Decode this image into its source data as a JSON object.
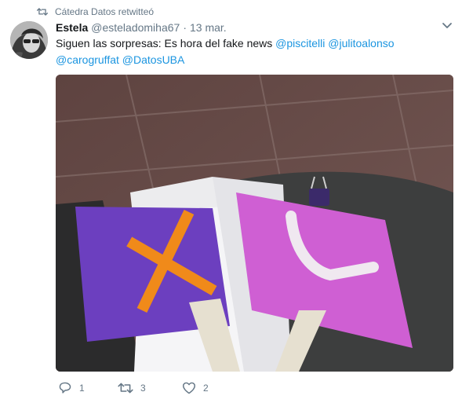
{
  "retweet_context": {
    "icon": "retweet-icon",
    "text": "Cátedra Datos retwitteó"
  },
  "tweet": {
    "author_name": "Estela",
    "author_handle": "@esteladomiha67",
    "separator": "·",
    "date": "13 mar.",
    "text_prefix": "Siguen las sorpresas: Es hora del fake news ",
    "mentions": [
      "@piscitelli",
      "@julitoalonso",
      "@carogruffat",
      "@DatosUBA"
    ],
    "media_icon": "photo-of-purple-and-pink-paper-signs"
  },
  "actions": {
    "reply": {
      "icon": "reply-icon",
      "count": "1"
    },
    "retweet": {
      "icon": "retweet-icon",
      "count": "3"
    },
    "like": {
      "icon": "heart-icon",
      "count": "2"
    }
  },
  "colors": {
    "link": "#1b95e0",
    "muted": "#657786",
    "text": "#14171a"
  }
}
